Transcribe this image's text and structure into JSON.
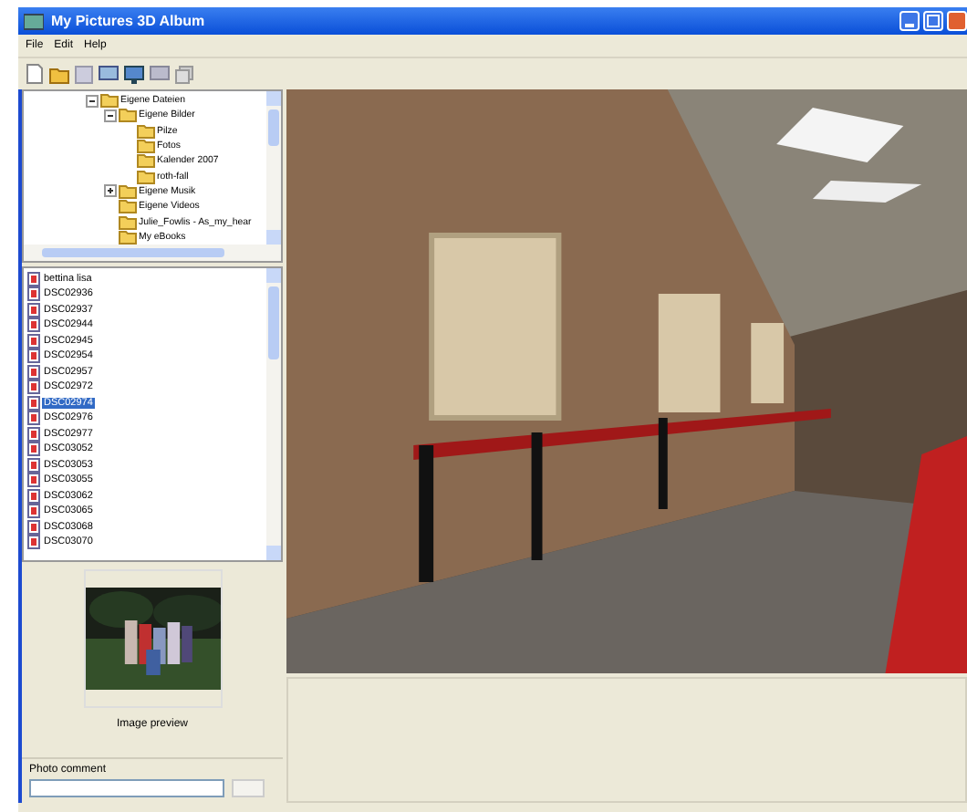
{
  "window": {
    "title": "My Pictures 3D Album"
  },
  "menu": [
    "File",
    "Edit",
    "Help"
  ],
  "tree": [
    {
      "label": "Eigene Dateien",
      "expanded": true,
      "children": [
        {
          "label": "Eigene Bilder",
          "expanded": true,
          "children": [
            {
              "label": "Pilze"
            },
            {
              "label": "Fotos"
            },
            {
              "label": "Kalender 2007"
            },
            {
              "label": "roth-fall"
            }
          ]
        },
        {
          "label": "Eigene Musik",
          "expanded": false
        },
        {
          "label": "Eigene Videos"
        },
        {
          "label": "Julie_Fowlis - As_my_hear"
        },
        {
          "label": "My eBooks"
        }
      ]
    }
  ],
  "files": [
    {
      "name": "bettina lisa",
      "selected": false
    },
    {
      "name": "DSC02936",
      "selected": false
    },
    {
      "name": "DSC02937",
      "selected": false
    },
    {
      "name": "DSC02944",
      "selected": false
    },
    {
      "name": "DSC02945",
      "selected": false
    },
    {
      "name": "DSC02954",
      "selected": false
    },
    {
      "name": "DSC02957",
      "selected": false
    },
    {
      "name": "DSC02972",
      "selected": false
    },
    {
      "name": "DSC02974",
      "selected": true
    },
    {
      "name": "DSC02976",
      "selected": false
    },
    {
      "name": "DSC02977",
      "selected": false
    },
    {
      "name": "DSC03052",
      "selected": false
    },
    {
      "name": "DSC03053",
      "selected": false
    },
    {
      "name": "DSC03055",
      "selected": false
    },
    {
      "name": "DSC03062",
      "selected": false
    },
    {
      "name": "DSC03065",
      "selected": false
    },
    {
      "name": "DSC03068",
      "selected": false
    },
    {
      "name": "DSC03070",
      "selected": false
    }
  ],
  "preview": {
    "caption": "Image preview"
  },
  "comment": {
    "label": "Photo comment"
  }
}
